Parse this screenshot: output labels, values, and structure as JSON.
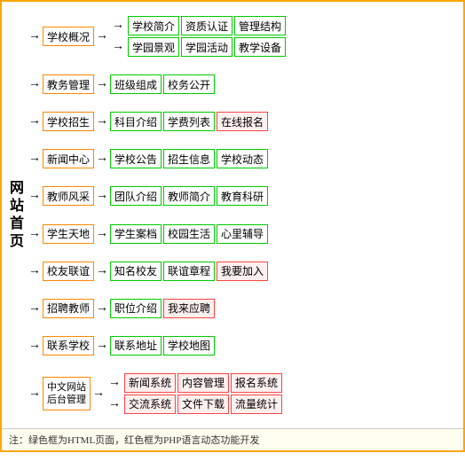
{
  "site": {
    "vertical_label": "网站首页",
    "rows": [
      {
        "id": "school-overview",
        "level1": "学校概况",
        "branches": [
          [
            "学校简介",
            "资质认证",
            "管理结构"
          ],
          [
            "学园景观",
            "学园活动",
            "教学设备"
          ]
        ],
        "branch_colors": [
          [
            "green",
            "green",
            "green"
          ],
          [
            "green",
            "green",
            "green"
          ]
        ]
      },
      {
        "id": "academic",
        "level1": "教务管理",
        "branches": [
          [
            "班级组成",
            "校务公开"
          ]
        ],
        "branch_colors": [
          [
            "green",
            "green"
          ]
        ]
      },
      {
        "id": "enrollment",
        "level1": "学校招生",
        "branches": [
          [
            "科目介绍",
            "学费列表",
            "在线报名"
          ]
        ],
        "branch_colors": [
          [
            "green",
            "green",
            "pink"
          ]
        ]
      },
      {
        "id": "news",
        "level1": "新闻中心",
        "branches": [
          [
            "学校公告",
            "招生信息",
            "学校动态"
          ]
        ],
        "branch_colors": [
          [
            "green",
            "green",
            "green"
          ]
        ]
      },
      {
        "id": "teachers",
        "level1": "教师风采",
        "branches": [
          [
            "团队介绍",
            "教师简介",
            "教育科研"
          ]
        ],
        "branch_colors": [
          [
            "green",
            "green",
            "green"
          ]
        ]
      },
      {
        "id": "students",
        "level1": "学生天地",
        "branches": [
          [
            "学生案档",
            "校园生活",
            "心里辅导"
          ]
        ],
        "branch_colors": [
          [
            "green",
            "green",
            "green"
          ]
        ]
      },
      {
        "id": "alumni",
        "level1": "校友联谊",
        "branches": [
          [
            "知名校友",
            "联谊章程",
            "我要加入"
          ]
        ],
        "branch_colors": [
          [
            "green",
            "green",
            "pink"
          ]
        ]
      },
      {
        "id": "recruit",
        "level1": "招聘教师",
        "branches": [
          [
            "职位介绍",
            "我来应聘"
          ]
        ],
        "branch_colors": [
          [
            "green",
            "pink"
          ]
        ]
      },
      {
        "id": "contact",
        "level1": "联系学校",
        "branches": [
          [
            "联系地址",
            "学校地图"
          ]
        ],
        "branch_colors": [
          [
            "green",
            "green"
          ]
        ]
      },
      {
        "id": "backend",
        "level1": "中文网站后台管理",
        "level1_double": true,
        "branches": [
          [
            "新闻系统",
            "内容管理",
            "报名系统"
          ],
          [
            "交流系统",
            "文件下载",
            "流量统计"
          ]
        ],
        "branch_colors": [
          [
            "pink",
            "pink",
            "pink"
          ],
          [
            "pink",
            "pink",
            "pink"
          ]
        ]
      }
    ],
    "footnote": "注：绿色框为HTML页面，红色框为PHP语言动态功能开发"
  }
}
